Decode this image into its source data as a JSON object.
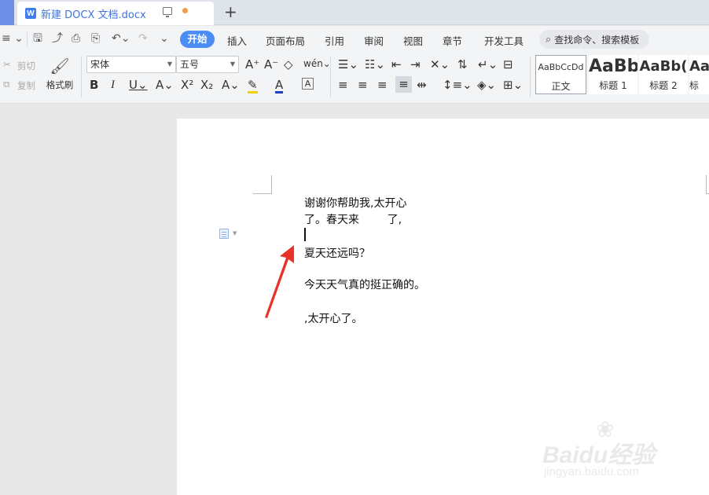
{
  "window": {
    "tab_title": "新建 DOCX 文档.docx",
    "new_tab_label": "+"
  },
  "menu": {
    "items": [
      "开始",
      "插入",
      "页面布局",
      "引用",
      "审阅",
      "视图",
      "章节",
      "开发工具"
    ],
    "active_index": 0,
    "search_placeholder": "查找命令、搜索模板"
  },
  "clipboard": {
    "cut_label": "剪切",
    "copy_label": "复制",
    "format_painter_label": "格式刷"
  },
  "font": {
    "family": "宋体",
    "size": "五号"
  },
  "styles": [
    {
      "sample": "AaBbCcDd",
      "name": "正文"
    },
    {
      "sample": "AaBb",
      "name": "标题 1"
    },
    {
      "sample": "AaBb(",
      "name": "标题 2"
    },
    {
      "sample": "Aa",
      "name": "标"
    }
  ],
  "document": {
    "lines": [
      "谢谢你帮助我,太开心",
      "了。春天来        了,",
      "",
      "夏天还远吗？",
      "",
      "今天天气真的挺正确的。",
      "",
      ",太开心了。"
    ]
  },
  "watermark": {
    "brand": "Baidu经验",
    "url": "jingyan.baidu.com"
  },
  "colors": {
    "accent": "#4c8cf5",
    "arrow": "#e8332a",
    "tab_bg": "#dfe3ea"
  }
}
